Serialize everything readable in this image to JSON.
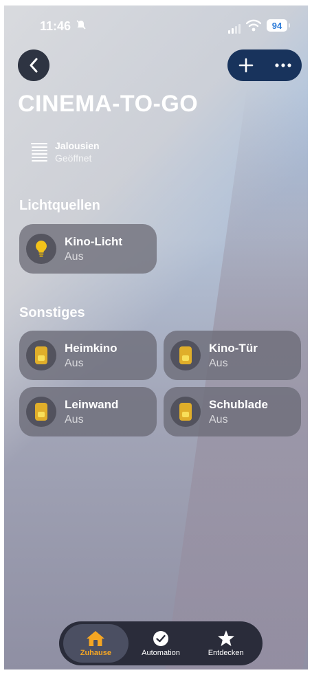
{
  "status": {
    "time": "11:46",
    "battery": "94"
  },
  "header": {
    "title": "CINEMA-TO-GO"
  },
  "blinds": {
    "name": "Jalousien",
    "state": "Geöffnet"
  },
  "sections": {
    "lights": "Lichtquellen",
    "other": "Sonstiges"
  },
  "lights": [
    {
      "name": "Kino-Licht",
      "state": "Aus"
    }
  ],
  "other": [
    {
      "name": "Heimkino",
      "state": "Aus"
    },
    {
      "name": "Kino-Tür",
      "state": "Aus"
    },
    {
      "name": "Leinwand",
      "state": "Aus"
    },
    {
      "name": "Schublade",
      "state": "Aus"
    }
  ],
  "tabs": [
    {
      "label": "Zuhause",
      "icon": "house-icon",
      "active": true
    },
    {
      "label": "Automation",
      "icon": "clock-check-icon",
      "active": false
    },
    {
      "label": "Entdecken",
      "icon": "star-icon",
      "active": false
    }
  ],
  "colors": {
    "accent": "#f5a623",
    "bulb": "#f2c21a",
    "outlet": "#e0ae2a",
    "pill": "#18335c"
  }
}
